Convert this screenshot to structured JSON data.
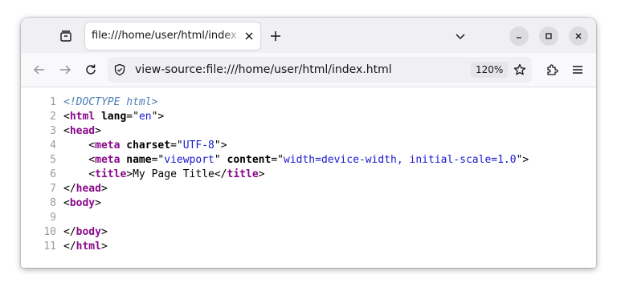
{
  "tab": {
    "title": "file:///home/user/html/index.html"
  },
  "urlbar": {
    "url": "view-source:file:///home/user/html/index.html",
    "zoom": "120%"
  },
  "source_lines": [
    {
      "n": "1",
      "parts": [
        {
          "c": "doctype",
          "t": "<!DOCTYPE html>"
        }
      ]
    },
    {
      "n": "2",
      "parts": [
        {
          "c": "txt",
          "t": "<"
        },
        {
          "c": "tag",
          "t": "html"
        },
        {
          "c": "txt",
          "t": " "
        },
        {
          "c": "attr",
          "t": "lang"
        },
        {
          "c": "txt",
          "t": "=\""
        },
        {
          "c": "val",
          "t": "en"
        },
        {
          "c": "txt",
          "t": "\">"
        }
      ]
    },
    {
      "n": "3",
      "parts": [
        {
          "c": "txt",
          "t": "<"
        },
        {
          "c": "tag",
          "t": "head"
        },
        {
          "c": "txt",
          "t": ">"
        }
      ]
    },
    {
      "n": "4",
      "parts": [
        {
          "c": "txt",
          "t": "    <"
        },
        {
          "c": "tag",
          "t": "meta"
        },
        {
          "c": "txt",
          "t": " "
        },
        {
          "c": "attr",
          "t": "charset"
        },
        {
          "c": "txt",
          "t": "=\""
        },
        {
          "c": "val",
          "t": "UTF-8"
        },
        {
          "c": "txt",
          "t": "\">"
        }
      ]
    },
    {
      "n": "5",
      "parts": [
        {
          "c": "txt",
          "t": "    <"
        },
        {
          "c": "tag",
          "t": "meta"
        },
        {
          "c": "txt",
          "t": " "
        },
        {
          "c": "attr",
          "t": "name"
        },
        {
          "c": "txt",
          "t": "=\""
        },
        {
          "c": "val",
          "t": "viewport"
        },
        {
          "c": "txt",
          "t": "\" "
        },
        {
          "c": "attr",
          "t": "content"
        },
        {
          "c": "txt",
          "t": "=\""
        },
        {
          "c": "val",
          "t": "width=device-width, initial-scale=1.0"
        },
        {
          "c": "txt",
          "t": "\">"
        }
      ]
    },
    {
      "n": "6",
      "parts": [
        {
          "c": "txt",
          "t": "    <"
        },
        {
          "c": "tag",
          "t": "title"
        },
        {
          "c": "txt",
          "t": ">My Page Title</"
        },
        {
          "c": "tag",
          "t": "title"
        },
        {
          "c": "txt",
          "t": ">"
        }
      ]
    },
    {
      "n": "7",
      "parts": [
        {
          "c": "txt",
          "t": "</"
        },
        {
          "c": "tag",
          "t": "head"
        },
        {
          "c": "txt",
          "t": ">"
        }
      ]
    },
    {
      "n": "8",
      "parts": [
        {
          "c": "txt",
          "t": "<"
        },
        {
          "c": "tag",
          "t": "body"
        },
        {
          "c": "txt",
          "t": ">"
        }
      ]
    },
    {
      "n": "9",
      "parts": []
    },
    {
      "n": "10",
      "parts": [
        {
          "c": "txt",
          "t": "</"
        },
        {
          "c": "tag",
          "t": "body"
        },
        {
          "c": "txt",
          "t": ">"
        }
      ]
    },
    {
      "n": "11",
      "parts": [
        {
          "c": "txt",
          "t": "</"
        },
        {
          "c": "tag",
          "t": "html"
        },
        {
          "c": "txt",
          "t": ">"
        }
      ]
    }
  ],
  "icons": {
    "tab_list": "tab-list-icon",
    "tab_close": "close-icon",
    "new_tab": "plus-icon",
    "tab_overflow": "chevron-down-icon",
    "minimize": "minimize-icon",
    "maximize": "maximize-icon",
    "close_window": "close-icon",
    "back": "arrow-left-icon",
    "forward": "arrow-right-icon",
    "reload": "reload-icon",
    "site_info": "shield-icon",
    "bookmark": "star-icon",
    "extensions": "puzzle-icon",
    "menu": "hamburger-icon"
  },
  "colors": {
    "tag": "#8a0a8a",
    "attribute_value": "#1a1ad0",
    "doctype": "#4b7eb5",
    "line_number": "#9a9aa2"
  }
}
